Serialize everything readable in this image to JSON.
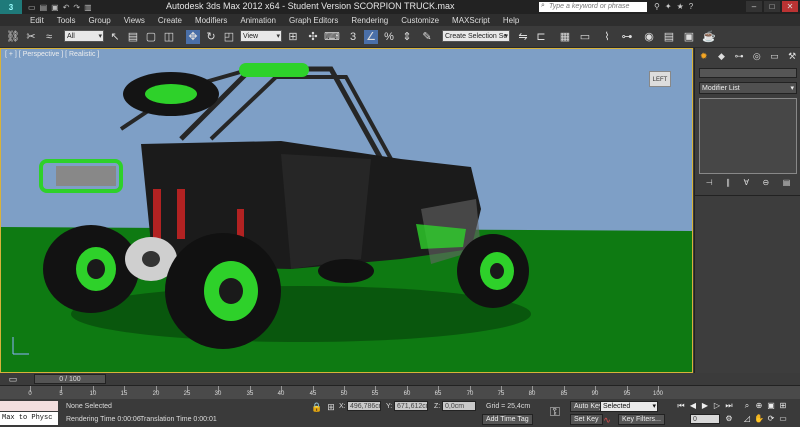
{
  "title_bar": {
    "app_title": "Autodesk 3ds Max  2012 x64  - Student Version    SCORPION TRUCK.max",
    "search_placeholder": "Type a keyword or phrase",
    "min": "–",
    "max": "□",
    "close": "✕"
  },
  "menu": [
    "Edit",
    "Tools",
    "Group",
    "Views",
    "Create",
    "Modifiers",
    "Animation",
    "Graph Editors",
    "Rendering",
    "Customize",
    "MAXScript",
    "Help"
  ],
  "toolbar": {
    "selection_filter": "All",
    "ref_coord": "View",
    "named_selection": "Create Selection Se"
  },
  "viewport": {
    "label": "[ + ] [ Perspective ] [ Realistic ]",
    "viewcube_label": "LEFT",
    "colors": {
      "sky": "#7e9fc6",
      "ground": "#0e7a12",
      "accent_green": "#2ed12a",
      "body": "#1b1b1b"
    }
  },
  "command_panel": {
    "modifier_list": "Modifier List"
  },
  "timeline": {
    "slider_text": "0 / 100",
    "ruler": [
      "0",
      "5",
      "10",
      "15",
      "20",
      "25",
      "30",
      "35",
      "40",
      "45",
      "50",
      "55",
      "60",
      "65",
      "70",
      "75",
      "80",
      "85",
      "90",
      "95",
      "100"
    ]
  },
  "status": {
    "maxscript_top": "",
    "maxscript_input": "Max to Physc",
    "selection_status": "None Selected",
    "rendering_time": "Rendering Time  0:00:06",
    "translation_time": "Translation Time  0:00:01",
    "x_label": "X:",
    "x_value": "496,786cm",
    "y_label": "Y:",
    "y_value": "671,612cm",
    "z_label": "Z:",
    "z_value": "0,0cm",
    "grid": "Grid = 25,4cm",
    "add_time_tag": "Add Time Tag",
    "auto_key": "Auto Key",
    "set_key": "Set Key",
    "selected_option": "Selected",
    "key_filters": "Key Filters...",
    "frame_value": "0"
  }
}
